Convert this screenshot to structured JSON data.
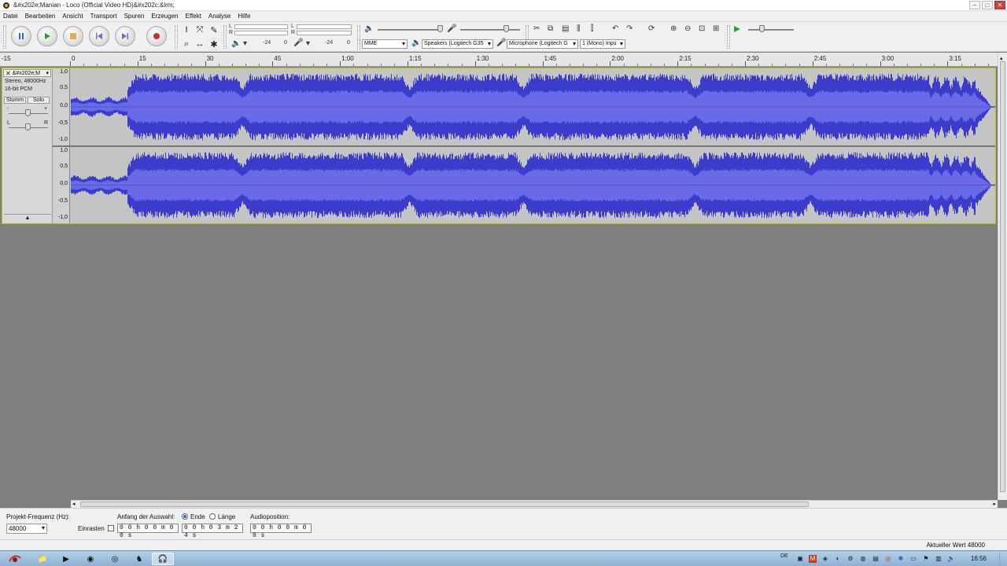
{
  "window": {
    "title": "&#x202e;Manian - Loco (Official Video HD)&#x202c;&lrm;",
    "controls": {
      "minimize": "–",
      "maximize": "□",
      "close": "✕"
    }
  },
  "menu": [
    "Datei",
    "Bearbeiten",
    "Ansicht",
    "Transport",
    "Spuren",
    "Erzeugen",
    "Effekt",
    "Analyse",
    "Hilfe"
  ],
  "meters": {
    "play_left": "L",
    "play_right": "R",
    "rec_left": "L",
    "rec_right": "R",
    "play_scale_a": "-24",
    "play_scale_b": "0",
    "rec_scale_a": "-24",
    "rec_scale_b": "0"
  },
  "devices": {
    "host": "MME",
    "output": "Speakers (Logitech G35",
    "input": "Microphone (Logitech G",
    "channels": "1 (Mono) Inpu"
  },
  "ruler": {
    "start_label": "-15",
    "labels": [
      "0",
      "15",
      "30",
      "45",
      "1:00",
      "1:15",
      "1:30",
      "1:45",
      "2:00",
      "2:15",
      "2:30",
      "2:45",
      "3:00",
      "3:15"
    ]
  },
  "track": {
    "name": "&#x202e;M",
    "format": "Stereo, 48000Hz",
    "bit_depth": "16-bit PCM",
    "mute": "Stumm",
    "solo": "Solo",
    "gain_minus": "-",
    "gain_plus": "+",
    "pan_left": "L",
    "pan_right": "R",
    "scale": [
      "1,0",
      "0,5",
      "0,0",
      "-0,5",
      "-1,0"
    ],
    "waveform_color": "#3b3bcc",
    "rms_color": "#6a6ae6"
  },
  "selection": {
    "rate_label": "Projekt-Frequenz (Hz):",
    "rate_value": "48000",
    "snap_label": "Einrasten",
    "start_label": "Anfang der Auswahl:",
    "end_option": "Ende",
    "length_option": "Länge",
    "position_label": "Audioposition:",
    "start_time": "0 0 h 0 0 m 0 0 s",
    "end_time": "0 0 h 0 3 m 2 4 s",
    "position_time": "0 0 h 0 0 m 0 0 s"
  },
  "status": {
    "text": "Aktueller Wert 48000"
  },
  "taskbar": {
    "lang": "DE",
    "clock": "16:56"
  }
}
